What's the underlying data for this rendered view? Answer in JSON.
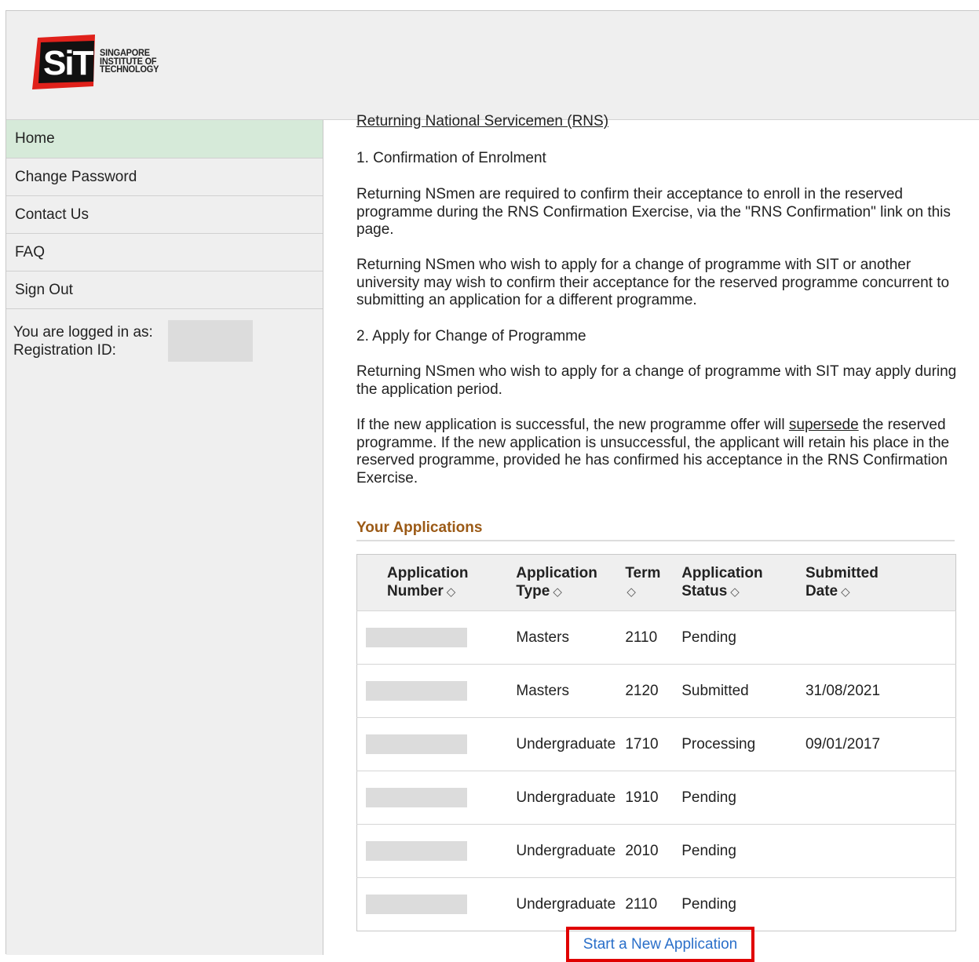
{
  "logo": {
    "mark": "SiT",
    "lines": [
      "SINGAPORE",
      "INSTITUTE OF",
      "TECHNOLOGY"
    ]
  },
  "sidebar": {
    "items": [
      {
        "label": "Home",
        "active": true
      },
      {
        "label": "Change Password"
      },
      {
        "label": "Contact Us"
      },
      {
        "label": "FAQ"
      },
      {
        "label": "Sign Out"
      }
    ],
    "login_label": "You are logged in as:",
    "registration_label": "Registration ID:"
  },
  "main": {
    "rns_title": "Returning National Servicemen (RNS)",
    "section1_title": "1. Confirmation of Enrolment",
    "para1": "Returning NSmen are required to confirm their acceptance to enroll in the reserved programme during the RNS Confirmation Exercise, via the \"RNS Confirmation\" link on this page.",
    "para2": "Returning NSmen who wish to apply for a change of programme with SIT or another university may wish to confirm their acceptance for the reserved programme concurrent to submitting an application for a different programme.",
    "section2_title": "2. Apply for Change of Programme",
    "para3": "Returning NSmen who wish to apply for a change of programme with SIT may apply during the application period.",
    "para4_before": "If the new application is successful, the new programme offer will ",
    "para4_underlined": "supersede",
    "para4_after": " the reserved programme. If the new application is unsuccessful, the applicant will retain his place in the reserved programme, provided he has confirmed his acceptance in the RNS Confirmation Exercise.",
    "applications_heading": "Your Applications",
    "table": {
      "headers": {
        "number_line1": "Application",
        "number_line2": "Number",
        "type_line1": "Application",
        "type_line2": "Type",
        "term": "Term",
        "status_line1": "Application",
        "status_line2": "Status",
        "date_line1": "Submitted",
        "date_line2": "Date"
      },
      "rows": [
        {
          "type": "Masters",
          "term": "2110",
          "status": "Pending",
          "date": ""
        },
        {
          "type": "Masters",
          "term": "2120",
          "status": "Submitted",
          "date": "31/08/2021"
        },
        {
          "type": "Undergraduate",
          "term": "1710",
          "status": "Processing",
          "date": "09/01/2017"
        },
        {
          "type": "Undergraduate",
          "term": "1910",
          "status": "Pending",
          "date": ""
        },
        {
          "type": "Undergraduate",
          "term": "2010",
          "status": "Pending",
          "date": ""
        },
        {
          "type": "Undergraduate",
          "term": "2110",
          "status": "Pending",
          "date": ""
        }
      ]
    },
    "new_application_link": "Start a New Application"
  },
  "colors": {
    "active_nav": "#d6ead9",
    "heading": "#9b5a16",
    "link": "#2a6fc9",
    "highlight_box": "#e00000",
    "logo_red": "#e0211b"
  },
  "icons": {
    "sort": "sort-icon"
  }
}
